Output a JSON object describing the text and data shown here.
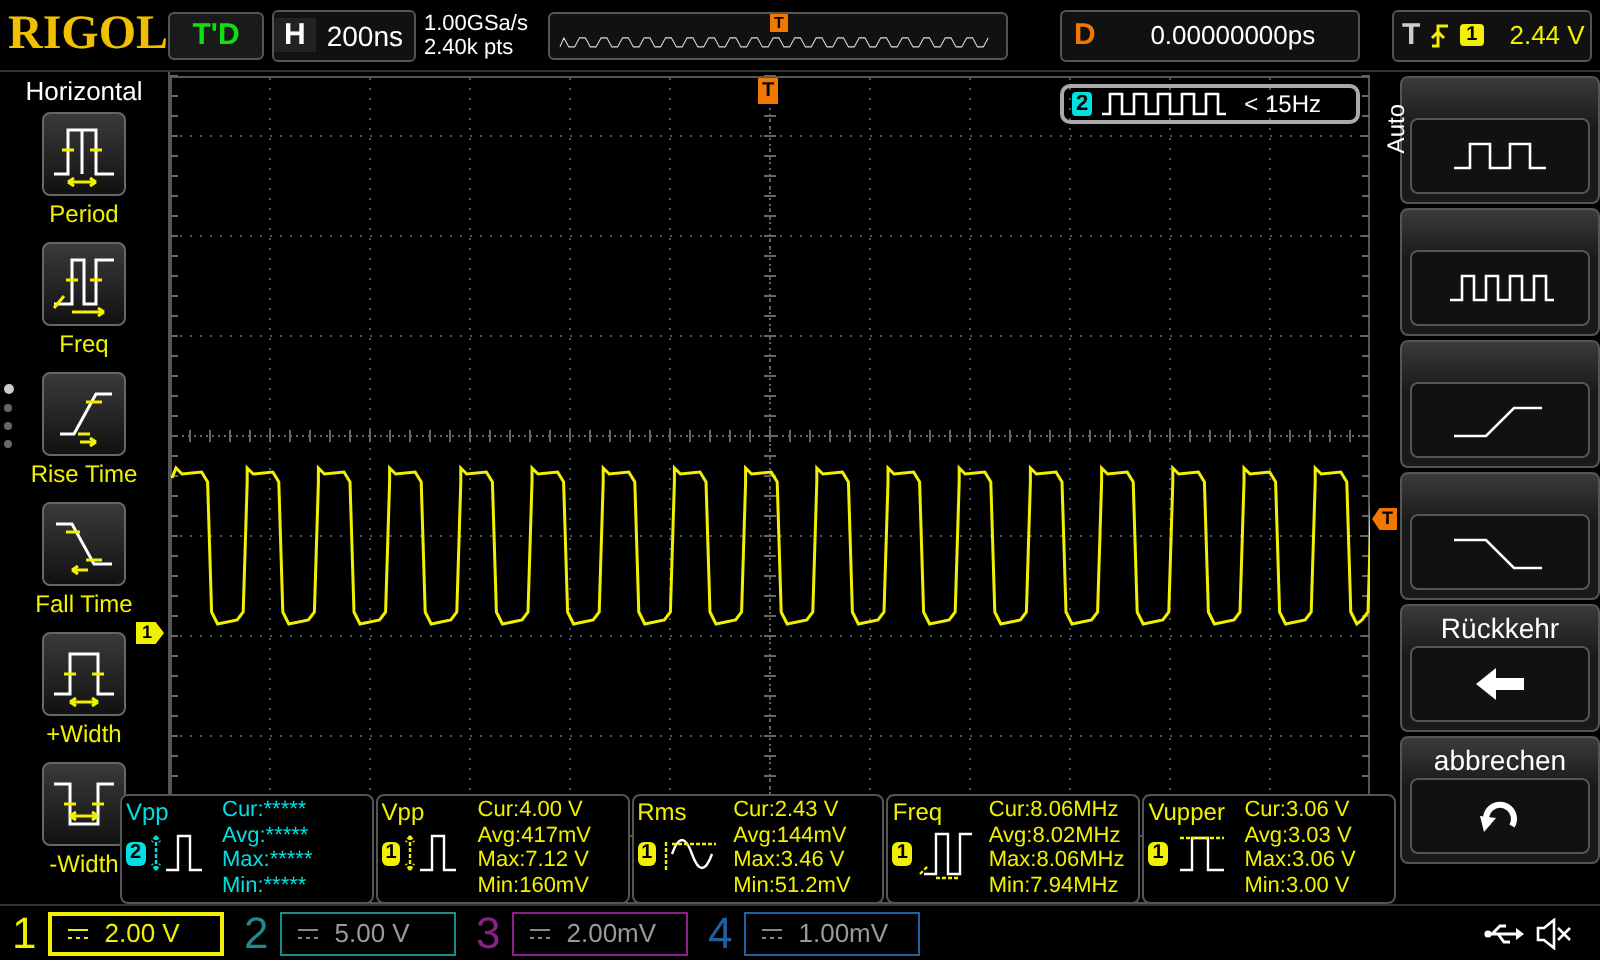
{
  "top_bar": {
    "logo": "RIGOL",
    "run_state": "T'D",
    "horizontal": {
      "label": "H",
      "value": "200ns"
    },
    "sample_rate": "1.00GSa/s",
    "memory_depth": "2.40k pts",
    "delay": {
      "label": "D",
      "value": "0.00000000ps"
    },
    "trigger": {
      "label": "T",
      "channel": "1",
      "level": "2.44 V"
    }
  },
  "left_menu": {
    "title": "Horizontal",
    "items": [
      {
        "kind": "period",
        "label": "Period"
      },
      {
        "kind": "freq",
        "label": "Freq"
      },
      {
        "kind": "rise",
        "label": "Rise Time"
      },
      {
        "kind": "fall",
        "label": "Fall Time"
      },
      {
        "kind": "pwidth",
        "label": "+Width"
      },
      {
        "kind": "nwidth",
        "label": "-Width"
      }
    ],
    "pages": [
      {
        "selected": true
      },
      {
        "selected": false
      },
      {
        "selected": false
      },
      {
        "selected": false
      }
    ]
  },
  "overview": {
    "trigger_marker": "T"
  },
  "markers": {
    "trigger_position": "T",
    "trigger_level": "T",
    "channel": "1"
  },
  "frequency_counter": {
    "channel": "2",
    "value": "< 15Hz"
  },
  "right_menu": {
    "tab": "Auto",
    "items": [
      {
        "kind": "square_slow"
      },
      {
        "kind": "square_fast"
      },
      {
        "kind": "rise"
      },
      {
        "kind": "fall"
      },
      {
        "kind": "back",
        "label": "Rückkehr"
      },
      {
        "kind": "undo",
        "label": "abbrechen"
      }
    ]
  },
  "measurements": [
    {
      "name": "Vpp",
      "channel": "2",
      "color": "#00e0e0",
      "kind": "vpp",
      "rows": [
        "Cur:*****",
        "Avg:*****",
        "Max:*****",
        "Min:*****"
      ]
    },
    {
      "name": "Vpp",
      "channel": "1",
      "color": "#f0f000",
      "kind": "vpp",
      "rows": [
        "Cur:4.00 V",
        "Avg:417mV",
        "Max:7.12 V",
        "Min:160mV"
      ]
    },
    {
      "name": "Rms",
      "channel": "1",
      "color": "#f0f000",
      "kind": "rms",
      "rows": [
        "Cur:2.43 V",
        "Avg:144mV",
        "Max:3.46 V",
        "Min:51.2mV"
      ]
    },
    {
      "name": "Freq",
      "channel": "1",
      "color": "#f0f000",
      "kind": "freq",
      "rows": [
        "Cur:8.06MHz",
        "Avg:8.02MHz",
        "Max:8.06MHz",
        "Min:7.94MHz"
      ]
    },
    {
      "name": "Vupper",
      "channel": "1",
      "color": "#f0f000",
      "kind": "vupper",
      "rows": [
        "Cur:3.06 V",
        "Avg:3.03 V",
        "Max:3.06 V",
        "Min:3.00 V"
      ]
    }
  ],
  "channels": [
    {
      "number": "1",
      "scale": "2.00 V",
      "selected": true,
      "color": "#f0f000"
    },
    {
      "number": "2",
      "scale": "5.00 V",
      "selected": false,
      "color": "#1e8a8a"
    },
    {
      "number": "3",
      "scale": "2.00mV",
      "selected": false,
      "color": "#8a208a"
    },
    {
      "number": "4",
      "scale": "1.00mV",
      "selected": false,
      "color": "#2060a0"
    }
  ]
}
